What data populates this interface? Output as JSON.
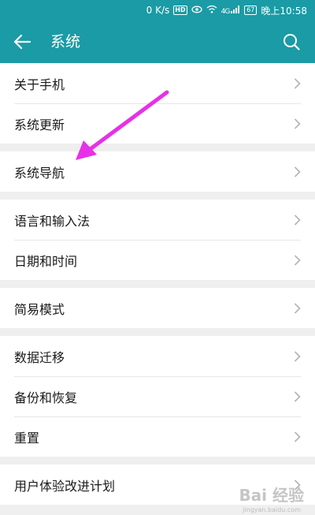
{
  "statusbar": {
    "speed": "0 K/s",
    "hd_badge": "HD",
    "signal": "4G",
    "battery": "67",
    "time": "晚上10:58"
  },
  "appbar": {
    "title": "系统",
    "back_icon": "arrow-left-icon",
    "search_icon": "search-icon"
  },
  "groups": [
    {
      "items": [
        {
          "label": "关于手机"
        },
        {
          "label": "系统更新"
        }
      ]
    },
    {
      "items": [
        {
          "label": "系统导航"
        }
      ]
    },
    {
      "items": [
        {
          "label": "语言和输入法"
        },
        {
          "label": "日期和时间"
        }
      ]
    },
    {
      "items": [
        {
          "label": "简易模式"
        }
      ]
    },
    {
      "items": [
        {
          "label": "数据迁移"
        },
        {
          "label": "备份和恢复"
        },
        {
          "label": "重置"
        }
      ]
    },
    {
      "items": [
        {
          "label": "用户体验改进计划"
        }
      ]
    }
  ],
  "annotation": {
    "color": "#e830e8"
  },
  "watermark": {
    "text": "Bai 经验",
    "url": "jingyan.baidu.com"
  },
  "colors": {
    "accent": "#1a9ba5",
    "chevron": "#b3b3b3"
  }
}
